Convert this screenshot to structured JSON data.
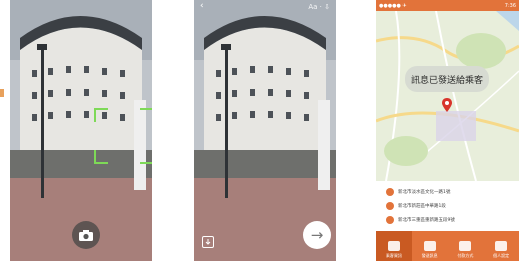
{
  "screen2": {
    "top_right_text": "Aa · ⇩"
  },
  "screen3": {
    "status_left": "●●●●● ✈",
    "status_right": "7:36",
    "bubble_text": "訊息已發送給乘客",
    "info": [
      "新北市淡水區文化一路1號",
      "新北市新莊區中華路1段",
      "新北市三重區重新路五段9號"
    ],
    "tabs": [
      "乘客資訊",
      "發送訊息",
      "付款方式",
      "個人設定"
    ]
  }
}
